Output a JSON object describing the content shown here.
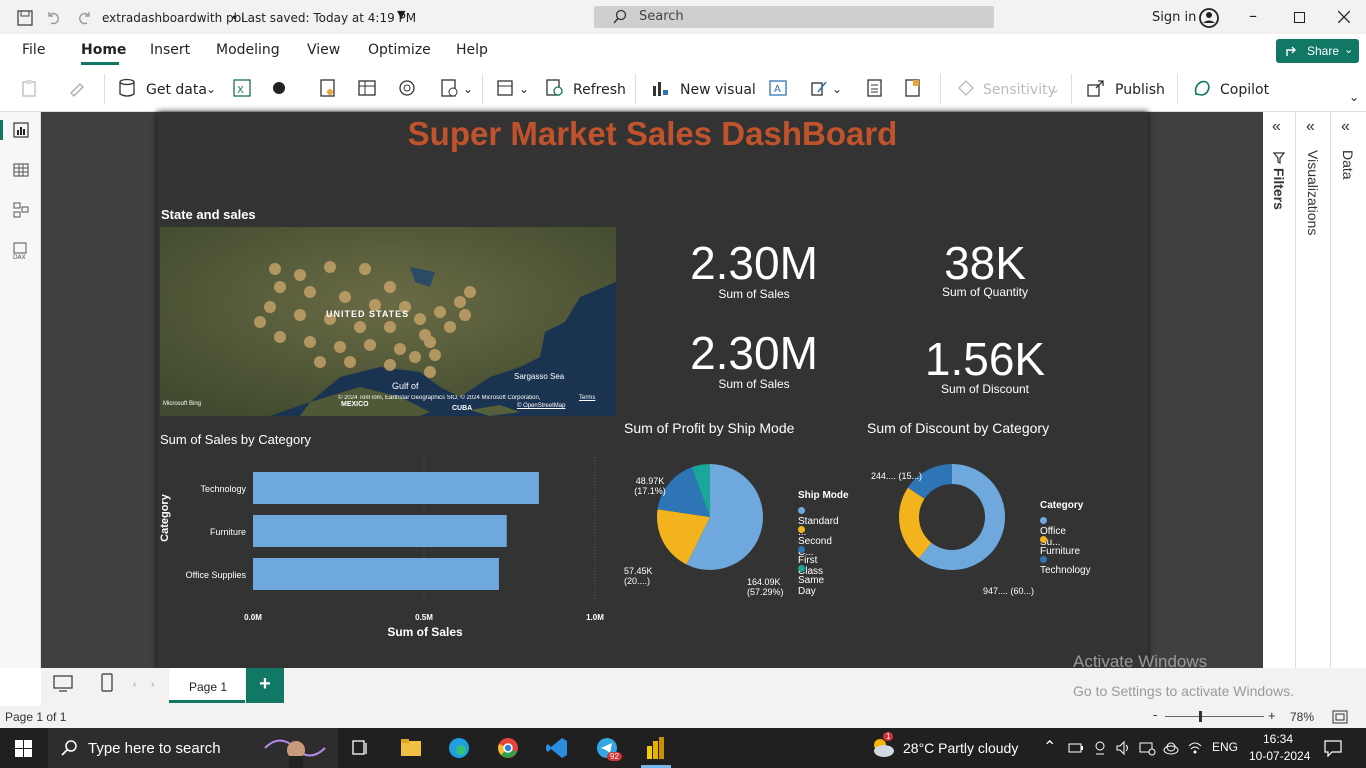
{
  "titlebar": {
    "file_name": "extradashboardwith pbi",
    "saved": "Last saved: Today at 4:19 PM",
    "search_placeholder": "Search",
    "sign_in": "Sign in"
  },
  "ribbon": {
    "tabs": [
      "File",
      "Home",
      "Insert",
      "Modeling",
      "View",
      "Optimize",
      "Help"
    ],
    "active": "Home",
    "share": "Share"
  },
  "toolbar": {
    "get_data": "Get data",
    "refresh": "Refresh",
    "new_visual": "New visual",
    "sensitivity": "Sensitivity",
    "publish": "Publish",
    "copilot": "Copilot"
  },
  "report": {
    "title": "Super Market Sales DashBoard",
    "map": {
      "title": "State and sales",
      "label_us": "UNITED STATES",
      "label_mexico": "MEXICO",
      "label_gulf": "Gulf of",
      "label_cuba": "CUBA",
      "label_sargasso": "Sargasso Sea",
      "credit": "© 2024 TomTom, Earthstar Geographics SIO, © 2024 Microsoft Corporation,",
      "terms": "Terms",
      "osm": "© OpenStreetMap",
      "bing": "Microsoft Bing"
    },
    "kpis": [
      {
        "value": "2.30M",
        "label": "Sum of Sales"
      },
      {
        "value": "38K",
        "label": "Sum of Quantity"
      },
      {
        "value": "2.30M",
        "label": "Sum of Sales"
      },
      {
        "value": "1.56K",
        "label": "Sum of Discount"
      }
    ]
  },
  "chart_data": [
    {
      "type": "bar",
      "title": "Sum of Sales by Category",
      "categories": [
        "Technology",
        "Furniture",
        "Office Supplies"
      ],
      "values": [
        836000,
        742000,
        719000
      ],
      "xlabel": "Sum of Sales",
      "ylabel": "Category",
      "xlim": [
        0,
        1000000
      ],
      "xticks": [
        "0.0M",
        "0.5M",
        "1.0M"
      ],
      "color": "#6fa8dc"
    },
    {
      "type": "pie",
      "title": "Sum of Profit by Ship Mode",
      "legend_title": "Ship Mode",
      "series": [
        {
          "name": "Standard ...",
          "value": 164090,
          "label": "164.09K (57.29%)",
          "color": "#6fa8dc"
        },
        {
          "name": "Second C...",
          "value": 57450,
          "label": "57.45K (20....)",
          "color": "#f2b31c"
        },
        {
          "name": "First Class",
          "value": 48970,
          "label": "48.97K (17.1%)",
          "color": "#2e75b6"
        },
        {
          "name": "Same Day",
          "value": 15900,
          "label": "",
          "color": "#1aa69a"
        }
      ]
    },
    {
      "type": "pie",
      "donut": true,
      "title": "Sum of Discount by Category",
      "legend_title": "Category",
      "series": [
        {
          "name": "Office Su...",
          "value": 947,
          "label": "947.... (60...)",
          "color": "#6fa8dc"
        },
        {
          "name": "Furniture",
          "value": 368,
          "label": "",
          "color": "#f2b31c"
        },
        {
          "name": "Technology",
          "value": 244,
          "label": "244.... (15...)",
          "color": "#2e75b6"
        }
      ]
    }
  ],
  "panes": {
    "filters": "Filters",
    "visualizations": "Visualizations",
    "data": "Data"
  },
  "pagebar": {
    "page": "Page 1",
    "add": "+"
  },
  "status": {
    "page_of": "Page 1 of 1",
    "zoom": "78%"
  },
  "watermark": {
    "line1": "Activate Windows",
    "line2": "Go to Settings to activate Windows."
  },
  "taskbar": {
    "search": "Type here to search",
    "weather": "28°C  Partly cloudy",
    "lang": "ENG",
    "time": "16:34",
    "date": "10-07-2024",
    "badge_telegram": "92",
    "badge_weather": "1"
  }
}
